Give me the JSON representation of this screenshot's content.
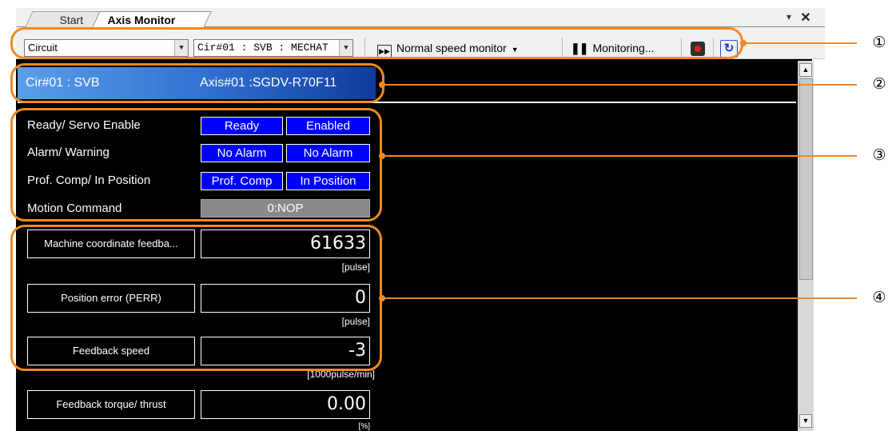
{
  "tabs": {
    "start": "Start",
    "axis_monitor": "Axis Monitor"
  },
  "window_buttons": {
    "pin": "▾",
    "close": "✕"
  },
  "toolbar": {
    "circuit_select": "Circuit",
    "axis_select": "Cir#01 : SVB : MECHAT",
    "monitor_mode": "Normal speed monitor",
    "monitoring": "Monitoring...",
    "record_icon": "record-icon",
    "refresh_icon": "refresh-icon"
  },
  "header": {
    "circuit": "Cir#01 : SVB",
    "axis": "Axis#01 :SGDV-R70F11"
  },
  "status": {
    "rows": [
      {
        "label": "Ready/ Servo Enable",
        "v1": "Ready",
        "v2": "Enabled"
      },
      {
        "label": "Alarm/ Warning",
        "v1": "No Alarm",
        "v2": "No Alarm"
      },
      {
        "label": "Prof. Comp/ In Position",
        "v1": "Prof. Comp",
        "v2": "In Position"
      }
    ],
    "motion_label": "Motion Command",
    "motion_value": "0:NOP"
  },
  "monitors": [
    {
      "label": "Machine coordinate feedba...",
      "value": "61633",
      "unit": "[pulse]"
    },
    {
      "label": "Position error (PERR)",
      "value": "0",
      "unit": "[pulse]"
    },
    {
      "label": "Feedback speed",
      "value": "-3",
      "unit": "[1000pulse/min]"
    },
    {
      "label": "Feedback torque/ thrust",
      "value": "0.00",
      "unit": "[%]"
    }
  ],
  "callouts": [
    "①",
    "②",
    "③",
    "④"
  ],
  "colors": {
    "callout": "#f08a1e",
    "status_blue": "#0000ff",
    "title_blue": "#2f6fd1"
  }
}
